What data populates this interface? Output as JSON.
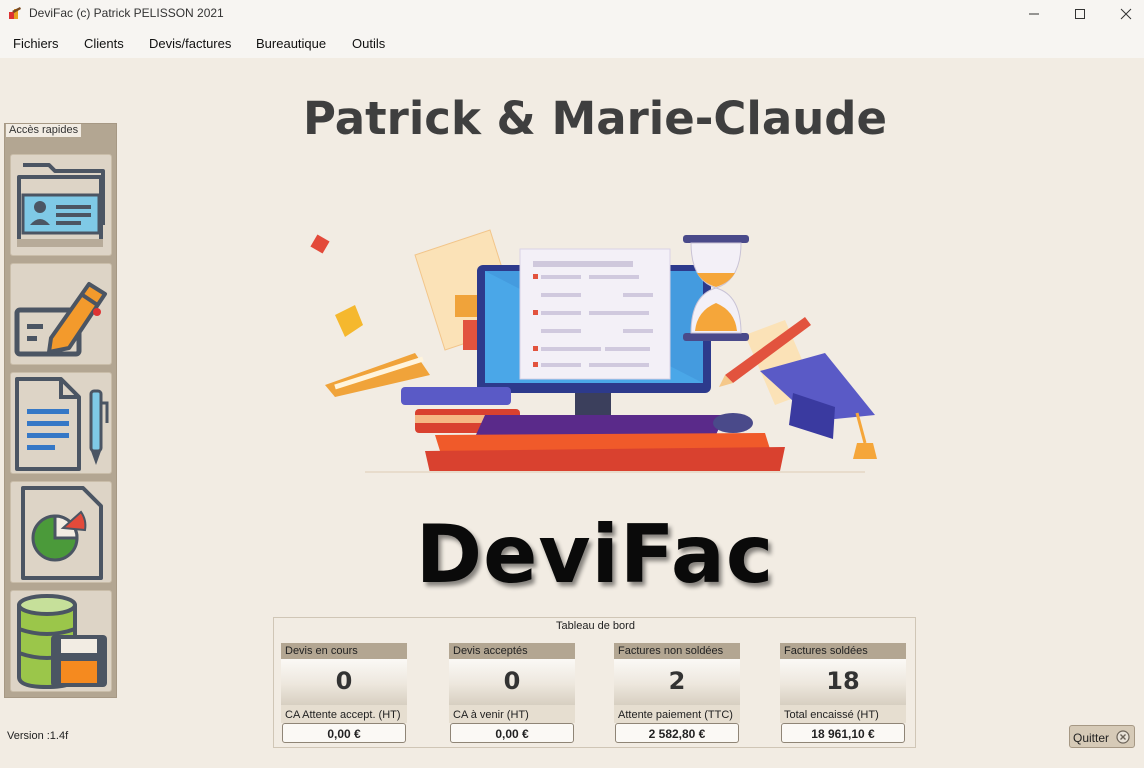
{
  "window": {
    "title": "DeviFac (c) Patrick PELISSON 2021"
  },
  "menu": [
    "Fichiers",
    "Clients",
    "Devis/factures",
    "Bureautique",
    "Outils"
  ],
  "quick_access": {
    "legend": "Accès rapides",
    "buttons": [
      "clients-folder-icon",
      "devis-edit-icon",
      "invoice-document-icon",
      "statistics-chart-icon",
      "database-save-icon"
    ]
  },
  "owner_name": "Patrick & Marie-Claude",
  "logo_text": "DeviFac",
  "dashboard": {
    "title": "Tableau de bord",
    "cards": [
      {
        "label": "Devis en cours",
        "count": "0",
        "sublabel": "CA Attente accept. (HT)",
        "amount": "0,00 €"
      },
      {
        "label": "Devis acceptés",
        "count": "0",
        "sublabel": "CA à venir (HT)",
        "amount": "0,00 €"
      },
      {
        "label": "Factures non soldées",
        "count": "2",
        "sublabel": "Attente paiement (TTC)",
        "amount": "2 582,80 €"
      },
      {
        "label": "Factures soldées",
        "count": "18",
        "sublabel": "Total encaissé (HT)",
        "amount": "18 961,10 €"
      }
    ]
  },
  "version": "Version  :1.4f",
  "quit_label": "Quitter",
  "colors": {
    "background": "#f2ece3",
    "sidebar": "#b3a692",
    "button_face": "#ddd4c6"
  }
}
